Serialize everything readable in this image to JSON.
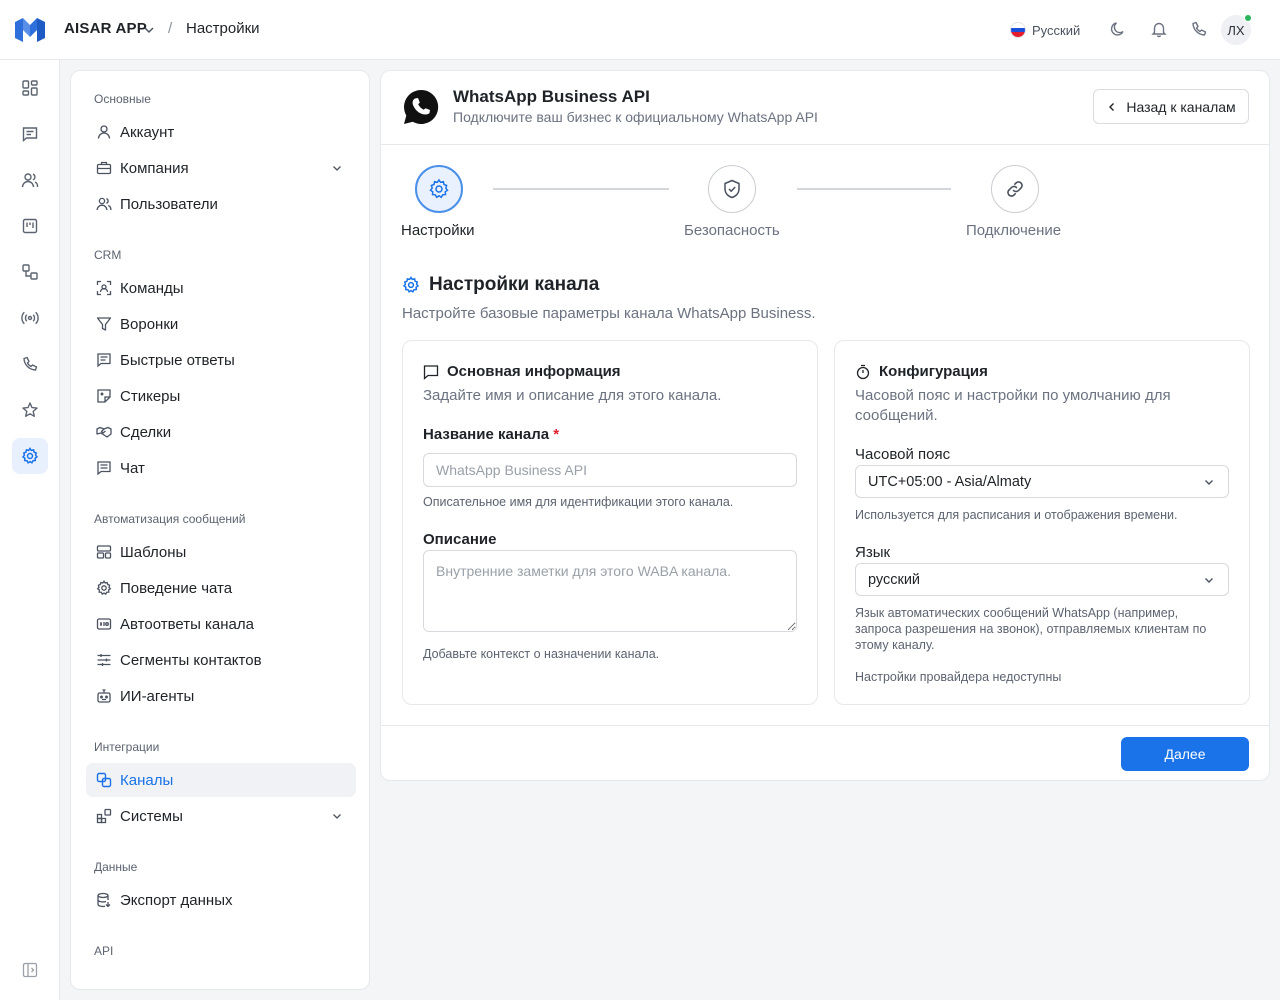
{
  "header": {
    "app_name": "AISAR APP",
    "breadcrumb_sep": "/",
    "breadcrumb_page": "Настройки",
    "language": "Русский",
    "avatar_initials": "ЛХ"
  },
  "rail": {
    "items": [
      "dashboard-icon",
      "chat-icon",
      "users-icon",
      "kanban-icon",
      "workflow-icon",
      "broadcast-icon",
      "phone-icon",
      "star-icon",
      "settings-icon"
    ],
    "active": "settings-icon"
  },
  "sidenav": {
    "sections": [
      {
        "title": "Основные",
        "items": [
          {
            "label": "Аккаунт",
            "icon": "user-icon"
          },
          {
            "label": "Компания",
            "icon": "briefcase-icon",
            "expandable": true
          },
          {
            "label": "Пользователи",
            "icon": "users-icon"
          }
        ]
      },
      {
        "title": "CRM",
        "items": [
          {
            "label": "Команды",
            "icon": "scan-icon"
          },
          {
            "label": "Воронки",
            "icon": "funnel-icon"
          },
          {
            "label": "Быстрые ответы",
            "icon": "message-square-icon"
          },
          {
            "label": "Стикеры",
            "icon": "sticker-icon"
          },
          {
            "label": "Сделки",
            "icon": "handshake-icon"
          },
          {
            "label": "Чат",
            "icon": "chat-lines-icon"
          }
        ]
      },
      {
        "title": "Автоматизация сообщений",
        "items": [
          {
            "label": "Шаблоны",
            "icon": "template-icon"
          },
          {
            "label": "Поведение чата",
            "icon": "gear-icon"
          },
          {
            "label": "Автоответы канала",
            "icon": "auto-reply-icon"
          },
          {
            "label": "Сегменты контактов",
            "icon": "sliders-icon"
          },
          {
            "label": "ИИ-агенты",
            "icon": "bot-icon"
          }
        ]
      },
      {
        "title": "Интеграции",
        "items": [
          {
            "label": "Каналы",
            "icon": "channels-icon",
            "active": true
          },
          {
            "label": "Системы",
            "icon": "blocks-icon",
            "expandable": true
          }
        ]
      },
      {
        "title": "Данные",
        "items": [
          {
            "label": "Экспорт данных",
            "icon": "database-icon"
          }
        ]
      },
      {
        "title": "API",
        "items": []
      }
    ]
  },
  "channel": {
    "title": "WhatsApp Business API",
    "subtitle": "Подключите ваш бизнес к официальному WhatsApp API",
    "back_label": "Назад к каналам"
  },
  "stepper": {
    "steps": [
      {
        "label": "Настройки",
        "icon": "gear-icon",
        "active": true
      },
      {
        "label": "Безопасность",
        "icon": "shield-check-icon",
        "active": false
      },
      {
        "label": "Подключение",
        "icon": "link-icon",
        "active": false
      }
    ]
  },
  "section": {
    "title": "Настройки канала",
    "subtitle": "Настройте базовые параметры канала WhatsApp Business."
  },
  "basic_info": {
    "title": "Основная информация",
    "subtitle": "Задайте имя и описание для этого канала.",
    "name_label": "Название канала",
    "name_required": "*",
    "name_placeholder": "WhatsApp Business API",
    "name_value": "",
    "name_hint": "Описательное имя для идентификации этого канала.",
    "desc_label": "Описание",
    "desc_placeholder": "Внутренние заметки для этого WABA канала.",
    "desc_value": "",
    "desc_hint": "Добавьте контекст о назначении канала."
  },
  "config": {
    "title": "Конфигурация",
    "subtitle_line1": "Часовой пояс и настройки по умолчанию для",
    "subtitle_line2": "сообщений.",
    "tz_label": "Часовой пояс",
    "tz_value": "UTC+05:00 - Asia/Almaty",
    "tz_hint": "Используется для расписания и отображения времени.",
    "lang_label": "Язык",
    "lang_value": "русский",
    "lang_hint_line1": "Язык автоматических сообщений WhatsApp (например,",
    "lang_hint_line2": "запроса разрешения на звонок), отправляемых клиентам по",
    "lang_hint_line3": "этому каналу.",
    "provider_note": "Настройки провайдера недоступны"
  },
  "footer": {
    "next_label": "Далее"
  },
  "colors": {
    "accent": "#1a73e8",
    "active_step_bg": "#e8f1fd",
    "required": "#e11d2e"
  }
}
